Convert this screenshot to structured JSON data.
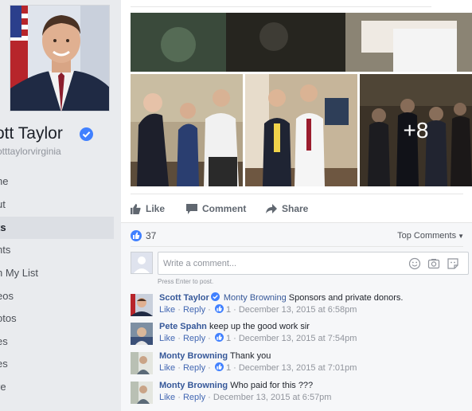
{
  "profile": {
    "name": "ott Taylor",
    "handle": "otttaylorvirginia"
  },
  "nav": {
    "items": [
      "ne",
      "ut",
      "ts",
      "nts",
      "n My List",
      "eos",
      "otos",
      "es",
      "es",
      "re"
    ],
    "active_index": 2
  },
  "post": {
    "more_photos_label": "+8",
    "actions": {
      "like": "Like",
      "comment": "Comment",
      "share": "Share"
    }
  },
  "comments_section": {
    "like_count": "37",
    "sort_label": "Top Comments",
    "input_placeholder": "Write a comment...",
    "press_enter_hint": "Press Enter to post.",
    "comments": [
      {
        "author": "Scott Taylor",
        "verified": true,
        "mention": "Monty Browning",
        "text": "Sponsors and private donors.",
        "like_label": "Like",
        "reply_label": "Reply",
        "reaction_count": "1",
        "timestamp": "December 13, 2015 at 6:58pm"
      },
      {
        "author": "Pete Spahn",
        "verified": false,
        "mention": "",
        "text": "keep up the good work sir",
        "like_label": "Like",
        "reply_label": "Reply",
        "reaction_count": "1",
        "timestamp": "December 13, 2015 at 7:54pm"
      },
      {
        "author": "Monty Browning",
        "verified": false,
        "mention": "",
        "text": "Thank you",
        "like_label": "Like",
        "reply_label": "Reply",
        "reaction_count": "1",
        "timestamp": "December 13, 2015 at 7:01pm"
      },
      {
        "author": "Monty Browning",
        "verified": false,
        "mention": "",
        "text": "Who paid for this ???",
        "like_label": "Like",
        "reply_label": "Reply",
        "reaction_count": "",
        "timestamp": "December 13, 2015 at 6:57pm"
      }
    ]
  },
  "colors": {
    "link_blue": "#365899",
    "verified_blue": "#4080ff",
    "page_bg": "#e9ebee"
  }
}
